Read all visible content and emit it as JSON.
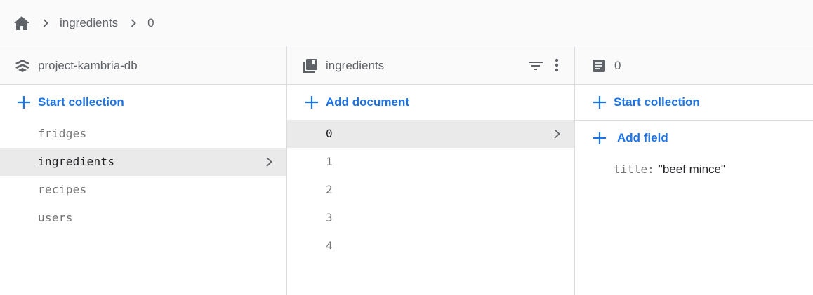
{
  "breadcrumb": {
    "home_icon": "home-icon",
    "items": [
      "ingredients",
      "0"
    ]
  },
  "root_panel": {
    "icon": "firestore-db-icon",
    "title": "project-kambria-db",
    "action_label": "Start collection",
    "collections": [
      "fridges",
      "ingredients",
      "recipes",
      "users"
    ],
    "selected": "ingredients"
  },
  "collection_panel": {
    "icon": "collection-icon",
    "title": "ingredients",
    "action_label": "Add document",
    "documents": [
      "0",
      "1",
      "2",
      "3",
      "4"
    ],
    "selected": "0"
  },
  "document_panel": {
    "icon": "document-icon",
    "title": "0",
    "start_collection_label": "Start collection",
    "add_field_label": "Add field",
    "fields": [
      {
        "key": "title:",
        "value": "\"beef mince\""
      }
    ]
  },
  "colors": {
    "accent": "#1a73e8",
    "selected_bg": "#eaeaea",
    "header_bg": "#fafafa",
    "border": "#dadce0"
  }
}
